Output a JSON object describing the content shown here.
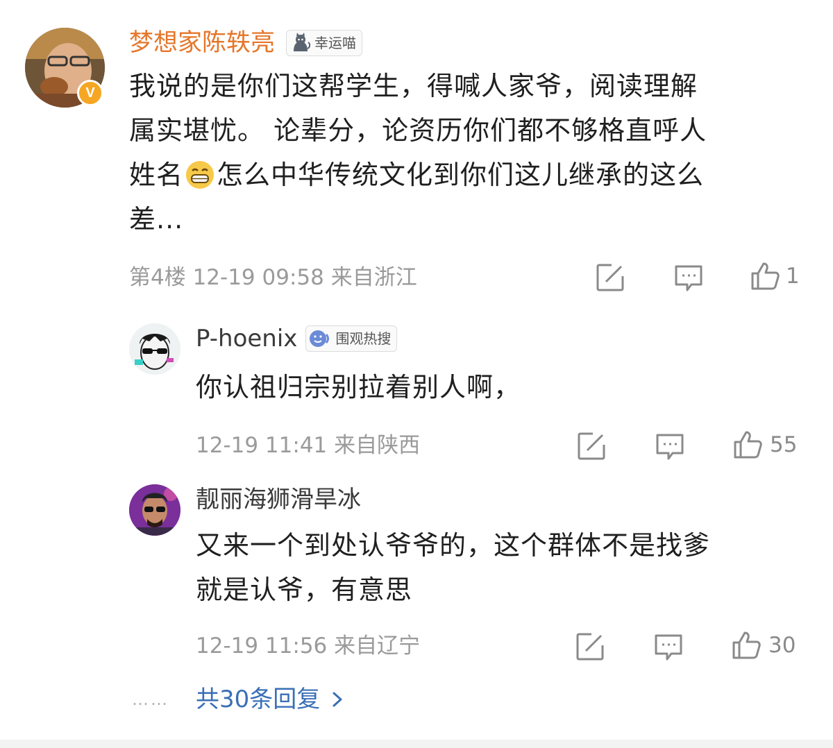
{
  "main_comment": {
    "username": "梦想家陈轶亮",
    "badge_label": "幸运喵",
    "text_lines": [
      "我说的是你们这帮学生，得喊人家爷，阅读理解",
      "属实堪忧。 论辈分，论资历你们都不够格直呼人",
      "姓名",
      "怎么中华传统文化到你们这儿继承的这么",
      "差..."
    ],
    "meta": "第4楼 12-19 09:58 来自浙江",
    "like_count": "1",
    "verified_mark": "V"
  },
  "replies": [
    {
      "username": "P-hoenix",
      "badge_label": "围观热搜",
      "text_lines": [
        "你认祖归宗别拉着别人啊，"
      ],
      "meta": "12-19 11:41 来自陕西",
      "like_count": "55"
    },
    {
      "username": "靓丽海狮滑旱冰",
      "text_lines": [
        "又来一个到处认爷爷的，这个群体不是找爹",
        "就是认爷，有意思"
      ],
      "meta": "12-19 11:56 来自辽宁",
      "like_count": "30"
    }
  ],
  "more_replies": {
    "label": "共30条回复",
    "dots": "……"
  },
  "colors": {
    "username_accent": "#e5762a",
    "link": "#3a6fb5",
    "meta": "#9a9a9a",
    "verified": "#f5a623"
  },
  "icons": [
    "edit-icon",
    "comment-icon",
    "like-icon",
    "chevron-right-icon",
    "cat-badge-icon",
    "smile-badge-icon",
    "grin-emoji-icon"
  ]
}
